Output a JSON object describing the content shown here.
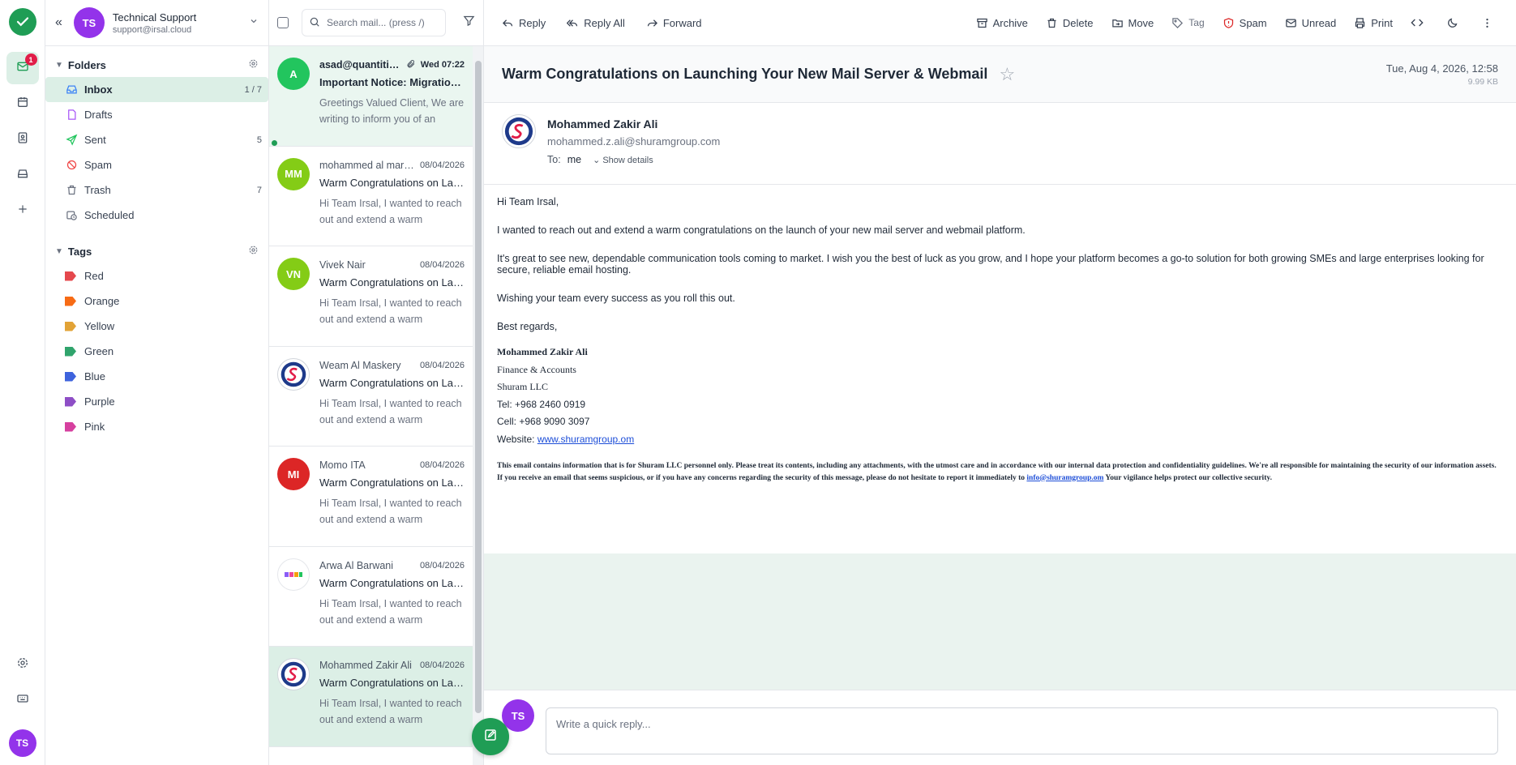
{
  "rail": {
    "badge": "1",
    "avatar": "TS"
  },
  "account": {
    "initials": "TS",
    "name": "Technical Support",
    "email": "support@irsal.cloud"
  },
  "folders": {
    "title": "Folders",
    "items": [
      {
        "label": "Inbox",
        "count": "1 / 7"
      },
      {
        "label": "Drafts",
        "count": ""
      },
      {
        "label": "Sent",
        "count": "5"
      },
      {
        "label": "Spam",
        "count": ""
      },
      {
        "label": "Trash",
        "count": "7"
      },
      {
        "label": "Scheduled",
        "count": ""
      }
    ]
  },
  "tags": {
    "title": "Tags",
    "items": [
      {
        "label": "Red",
        "color": "#e5484d"
      },
      {
        "label": "Orange",
        "color": "#f76b15"
      },
      {
        "label": "Yellow",
        "color": "#e2a336"
      },
      {
        "label": "Green",
        "color": "#30a46c"
      },
      {
        "label": "Blue",
        "color": "#3e63dd"
      },
      {
        "label": "Purple",
        "color": "#8e4ec6"
      },
      {
        "label": "Pink",
        "color": "#d6409f"
      }
    ]
  },
  "list": {
    "search_placeholder": "Search mail... (press /)",
    "messages": [
      {
        "initials": "A",
        "avatar_color": "#22c55e",
        "from": "asad@quantitive.en...",
        "date": "Wed 07:22",
        "subject": "Important Notice: Migration of You...",
        "preview": "Greetings Valued Client, We are writing to inform you of an upcomin..."
      },
      {
        "initials": "MM",
        "avatar_color": "#84cc16",
        "from": "mohammed al marhoobi",
        "date": "08/04/2026",
        "subject": "Warm Congratulations on Launching...",
        "preview": "Hi Team Irsal, I wanted to reach out and extend a warm congratulations..."
      },
      {
        "initials": "VN",
        "avatar_color": "#84cc16",
        "from": "Vivek Nair",
        "date": "08/04/2026",
        "subject": "Warm Congratulations on Launching...",
        "preview": "Hi Team Irsal, I wanted to reach out and extend a warm congratulations..."
      },
      {
        "initials": "",
        "avatar_color": "#ffffff",
        "from": "Weam Al Maskery",
        "date": "08/04/2026",
        "subject": "Warm Congratulations on Launching...",
        "preview": "Hi Team Irsal, I wanted to reach out and extend a warm congratulations..."
      },
      {
        "initials": "MI",
        "avatar_color": "#dc2626",
        "from": "Momo ITA",
        "date": "08/04/2026",
        "subject": "Warm Congratulations on Launching...",
        "preview": "Hi Team Irsal, I wanted to reach out and extend a warm congratulations..."
      },
      {
        "initials": "",
        "avatar_color": "#ffffff",
        "from": "Arwa Al Barwani",
        "date": "08/04/2026",
        "subject": "Warm Congratulations on Launching...",
        "preview": "Hi Team Irsal, I wanted to reach out and extend a warm congratulations..."
      },
      {
        "initials": "",
        "avatar_color": "#ffffff",
        "from": "Mohammed Zakir Ali",
        "date": "08/04/2026",
        "subject": "Warm Congratulations on Launching...",
        "preview": "Hi Team Irsal,   I wanted to reach out and extend a warm congratulatio..."
      }
    ]
  },
  "toolbar": {
    "reply": "Reply",
    "reply_all": "Reply All",
    "forward": "Forward",
    "archive": "Archive",
    "delete": "Delete",
    "move": "Move",
    "tag": "Tag",
    "spam": "Spam",
    "unread": "Unread",
    "print": "Print"
  },
  "email": {
    "subject": "Warm Congratulations on Launching Your New Mail Server & Webmail",
    "date": "Tue, Aug 4, 2026, 12:58",
    "size": "9.99 KB",
    "sender_name": "Mohammed Zakir Ali",
    "sender_email": "mohammed.z.ali@shuramgroup.com",
    "to_label": "To:",
    "to": "me",
    "show_details": "Show details",
    "paragraphs": [
      "Hi Team Irsal,",
      "I wanted to reach out and extend a warm congratulations on the launch of your new mail server and webmail platform.",
      "It's great to see new, dependable communication tools coming to market. I wish you the best of luck as you grow, and I hope your platform becomes a go-to solution for both growing SMEs and large enterprises looking for secure, reliable email hosting.",
      "Wishing your team every success as you roll this out.",
      "Best regards,"
    ],
    "signature": {
      "name": "Mohammed Zakir Ali",
      "dept": "Finance & Accounts",
      "company": "Shuram LLC",
      "tel": "Tel: +968 2460 0919",
      "cell": "Cell: +968 9090 3097",
      "website_label": "Website: ",
      "website": "www.shuramgroup.om"
    },
    "disclaimer_a": "This email contains information that is for Shuram LLC personnel only. Please treat its contents, including any attachments, with the utmost care and in accordance with our internal data protection and confidentiality guidelines. We're all responsible for maintaining the security of our information assets. If you receive an email that seems suspicious, or if you have any concerns regarding the security of this message, please do not hesitate to report it immediately to ",
    "disclaimer_link": "info@shuramgroup.om",
    "disclaimer_b": " Your vigilance helps protect our collective security."
  },
  "reply": {
    "avatar": "TS",
    "placeholder": "Write a quick reply..."
  }
}
